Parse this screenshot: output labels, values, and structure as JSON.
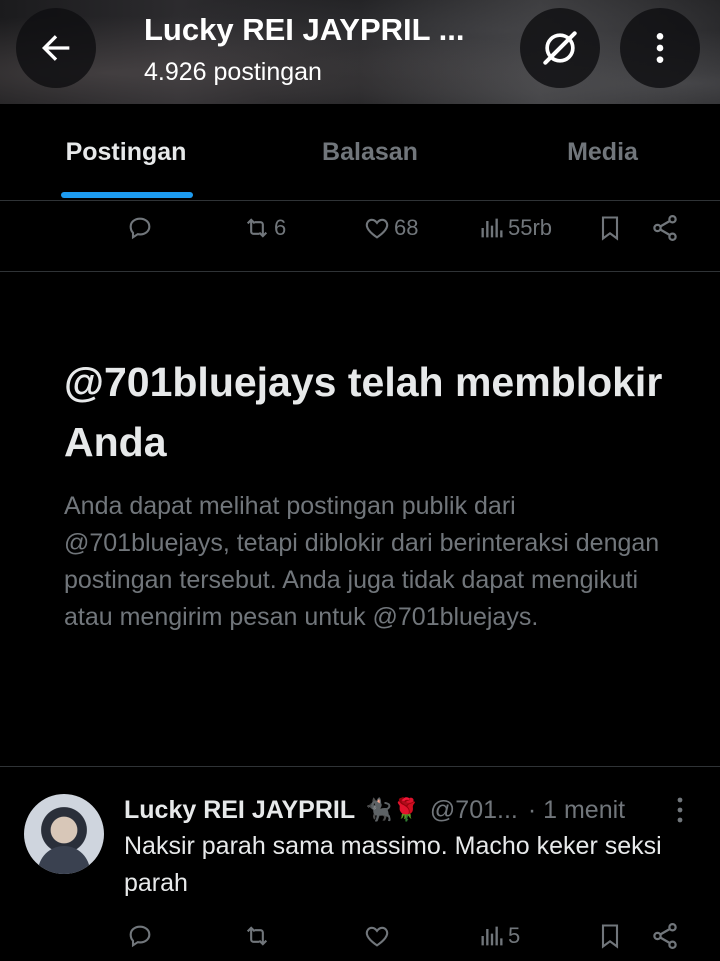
{
  "header": {
    "title": "Lucky REI JAYPRIL ...",
    "subtitle": "4.926 postingan"
  },
  "tabs": [
    {
      "label": "Postingan",
      "active": true
    },
    {
      "label": "Balasan",
      "active": false
    },
    {
      "label": "Media",
      "active": false
    }
  ],
  "top_post_actions": {
    "reply_count": "",
    "repost_count": "6",
    "like_count": "68",
    "views_count": "55rb"
  },
  "blocked_notice": {
    "title": "@701bluejays telah memblokir Anda",
    "description": "Anda dapat melihat postingan publik dari @701bluejays, tetapi diblokir dari berinteraksi dengan postingan tersebut. Anda juga tidak dapat mengikuti atau mengirim pesan untuk @701bluejays."
  },
  "post": {
    "name": "Lucky REI JAYPRIL",
    "emoji": "🐈‍⬛🌹",
    "handle": "@701...",
    "time": "· 1 menit",
    "text": "Naksir parah sama massimo. Macho keker seksi parah",
    "actions": {
      "reply_count": "",
      "repost_count": "",
      "like_count": "",
      "views_count": "5"
    }
  },
  "colors": {
    "background": "#000000",
    "accent": "#1d9bf0",
    "text_primary": "#e7e9ea",
    "text_secondary": "#71767b",
    "divider": "#2f3336"
  },
  "icons": [
    "back-arrow-icon",
    "grok-icon",
    "more-vertical-icon",
    "reply-icon",
    "repost-icon",
    "like-icon",
    "views-icon",
    "bookmark-icon",
    "share-icon"
  ]
}
